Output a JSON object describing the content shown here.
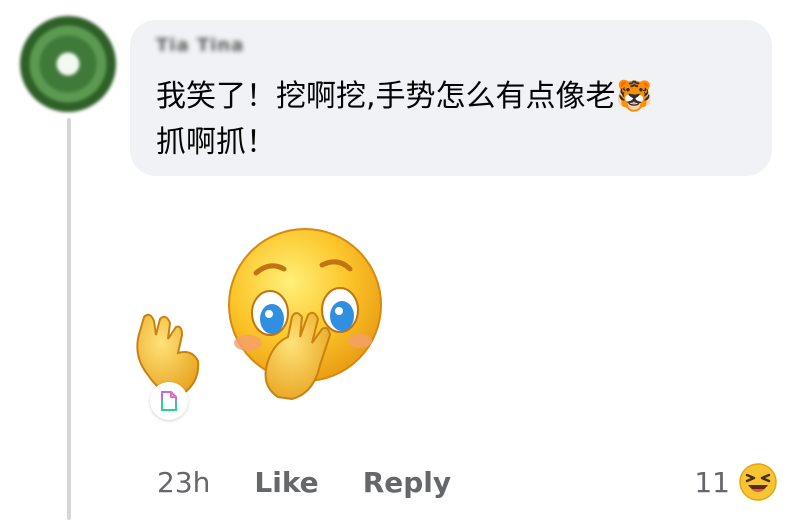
{
  "comment": {
    "author": "Tia Tina",
    "text": "我笑了！挖啊挖,手势怎么有点像老🐯\n抓啊抓！",
    "sticker_icon": "shy-covering-face-emoji-sticker",
    "attachment_icon": "file-icon"
  },
  "actions": {
    "time": "23h",
    "like_label": "Like",
    "reply_label": "Reply"
  },
  "reactions": {
    "count": "11",
    "icon": "laughing-squint-emoji"
  }
}
